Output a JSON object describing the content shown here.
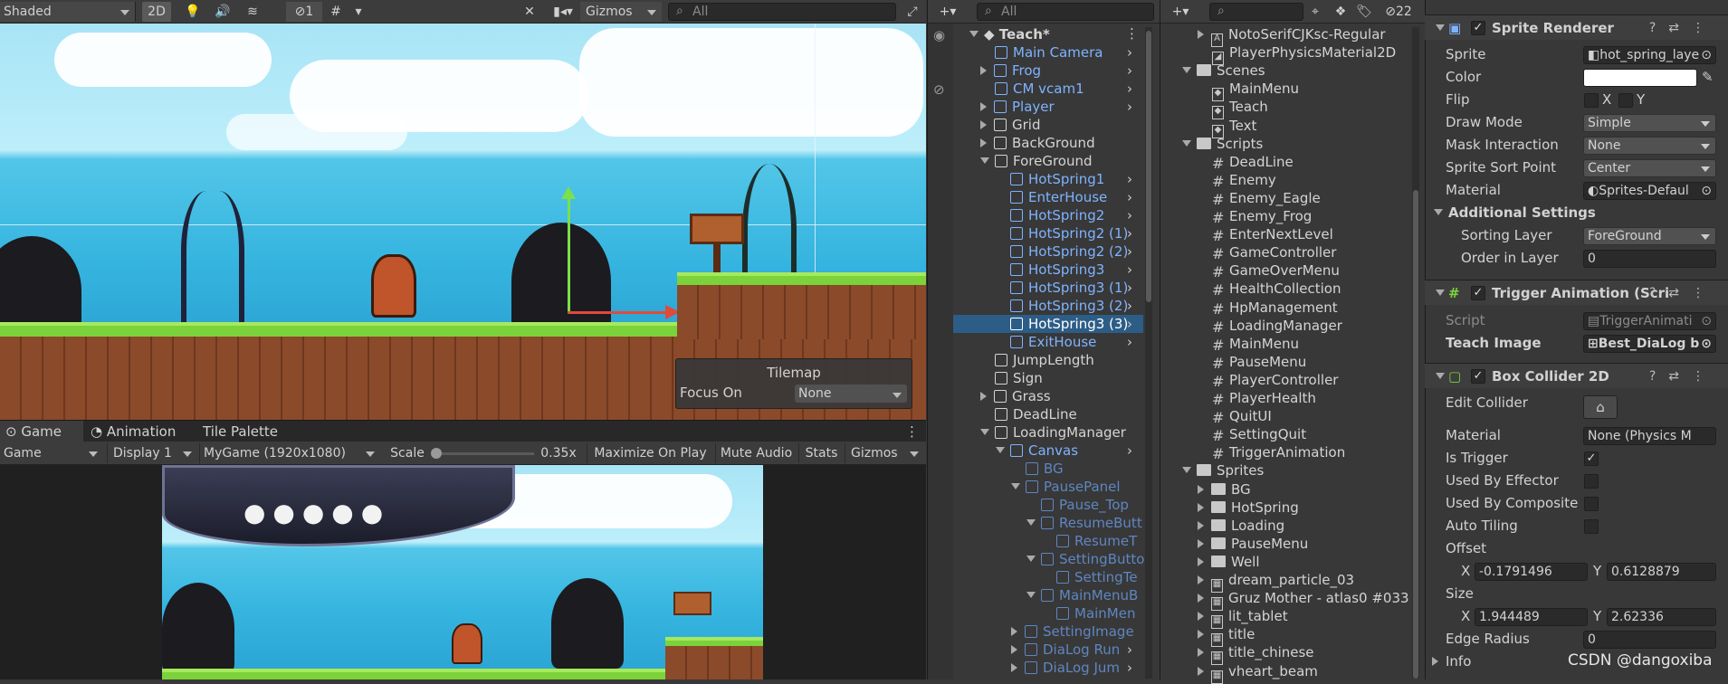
{
  "scene_toolbar": {
    "shading_mode": "Shaded",
    "mode_2d": "2D",
    "hidden_count": "1",
    "gizmos": "Gizmos",
    "search_placeholder": "All"
  },
  "tilemap_overlay": {
    "title": "Tilemap",
    "focus_label": "Focus On",
    "focus_value": "None"
  },
  "game_tabs": {
    "game": "Game",
    "animation": "Animation",
    "tile_palette": "Tile Palette"
  },
  "game_toolbar": {
    "view": "Game",
    "display": "Display 1",
    "resolution": "MyGame (1920x1080)",
    "scale_label": "Scale",
    "scale_value": "0.35x",
    "maximize": "Maximize On Play",
    "mute": "Mute Audio",
    "stats": "Stats",
    "gizmos": "Gizmos"
  },
  "hierarchy": {
    "search_placeholder": "All",
    "scene_name": "Teach*",
    "items": [
      {
        "label": "Main Camera",
        "indent": 1,
        "style": "blue",
        "expand": "",
        "chev": true
      },
      {
        "label": "Frog",
        "indent": 1,
        "style": "blue",
        "expand": "right",
        "chev": true
      },
      {
        "label": "CM vcam1",
        "indent": 1,
        "style": "blue",
        "expand": "",
        "chev": true
      },
      {
        "label": "Player",
        "indent": 1,
        "style": "blue",
        "expand": "right",
        "chev": true
      },
      {
        "label": "Grid",
        "indent": 1,
        "style": "",
        "expand": "right",
        "chev": false
      },
      {
        "label": "BackGround",
        "indent": 1,
        "style": "",
        "expand": "right",
        "chev": false
      },
      {
        "label": "ForeGround",
        "indent": 1,
        "style": "",
        "expand": "down",
        "chev": false
      },
      {
        "label": "HotSpring1",
        "indent": 2,
        "style": "blue",
        "expand": "",
        "chev": true
      },
      {
        "label": "EnterHouse",
        "indent": 2,
        "style": "blue",
        "expand": "",
        "chev": true
      },
      {
        "label": "HotSpring2",
        "indent": 2,
        "style": "blue",
        "expand": "",
        "chev": true
      },
      {
        "label": "HotSpring2 (1)",
        "indent": 2,
        "style": "blue",
        "expand": "",
        "chev": true
      },
      {
        "label": "HotSpring2 (2)",
        "indent": 2,
        "style": "blue",
        "expand": "",
        "chev": true
      },
      {
        "label": "HotSpring3",
        "indent": 2,
        "style": "blue",
        "expand": "",
        "chev": true
      },
      {
        "label": "HotSpring3 (1)",
        "indent": 2,
        "style": "blue",
        "expand": "",
        "chev": true
      },
      {
        "label": "HotSpring3 (2)",
        "indent": 2,
        "style": "blue",
        "expand": "",
        "chev": true
      },
      {
        "label": "HotSpring3 (3)",
        "indent": 2,
        "style": "selected",
        "expand": "",
        "chev": true
      },
      {
        "label": "ExitHouse",
        "indent": 2,
        "style": "blue",
        "expand": "",
        "chev": true
      },
      {
        "label": "JumpLength",
        "indent": 1,
        "style": "",
        "expand": "",
        "chev": false
      },
      {
        "label": "Sign",
        "indent": 1,
        "style": "",
        "expand": "",
        "chev": false
      },
      {
        "label": "Grass",
        "indent": 1,
        "style": "",
        "expand": "right",
        "chev": false
      },
      {
        "label": "DeadLine",
        "indent": 1,
        "style": "",
        "expand": "",
        "chev": false
      },
      {
        "label": "LoadingManager",
        "indent": 1,
        "style": "",
        "expand": "down",
        "chev": false
      },
      {
        "label": "Canvas",
        "indent": 2,
        "style": "blue",
        "expand": "down",
        "chev": true
      },
      {
        "label": "BG",
        "indent": 3,
        "style": "dim",
        "expand": "",
        "chev": false
      },
      {
        "label": "PausePanel",
        "indent": 3,
        "style": "dim",
        "expand": "down",
        "chev": false
      },
      {
        "label": "Pause_Top",
        "indent": 4,
        "style": "dim",
        "expand": "",
        "chev": false
      },
      {
        "label": "ResumeButt",
        "indent": 4,
        "style": "dim",
        "expand": "down",
        "chev": false
      },
      {
        "label": "ResumeT",
        "indent": 5,
        "style": "dim",
        "expand": "",
        "chev": false
      },
      {
        "label": "SettingButto",
        "indent": 4,
        "style": "dim",
        "expand": "down",
        "chev": false
      },
      {
        "label": "SettingTe",
        "indent": 5,
        "style": "dim",
        "expand": "",
        "chev": false
      },
      {
        "label": "MainMenuB",
        "indent": 4,
        "style": "dim",
        "expand": "down",
        "chev": false
      },
      {
        "label": "MainMen",
        "indent": 5,
        "style": "dim",
        "expand": "",
        "chev": false
      },
      {
        "label": "SettingImage",
        "indent": 3,
        "style": "dim",
        "expand": "right",
        "chev": false
      },
      {
        "label": "DiaLog Run",
        "indent": 3,
        "style": "dim",
        "expand": "right",
        "chev": true
      },
      {
        "label": "DiaLog Jum",
        "indent": 3,
        "style": "dim",
        "expand": "right",
        "chev": true
      }
    ]
  },
  "project": {
    "search_placeholder": "",
    "badge_count": "22",
    "items": [
      {
        "label": "NotoSerifCJKsc-Regular",
        "indent": 1,
        "icon": "font",
        "expand": "right"
      },
      {
        "label": "PlayerPhysicsMaterial2D",
        "indent": 1,
        "icon": "material",
        "expand": ""
      },
      {
        "label": "Scenes",
        "indent": 0,
        "icon": "folder",
        "expand": "down"
      },
      {
        "label": "MainMenu",
        "indent": 1,
        "icon": "scene",
        "expand": ""
      },
      {
        "label": "Teach",
        "indent": 1,
        "icon": "scene",
        "expand": ""
      },
      {
        "label": "Text",
        "indent": 1,
        "icon": "scene",
        "expand": ""
      },
      {
        "label": "Scripts",
        "indent": 0,
        "icon": "folder",
        "expand": "down"
      },
      {
        "label": "DeadLine",
        "indent": 1,
        "icon": "script",
        "expand": ""
      },
      {
        "label": "Enemy",
        "indent": 1,
        "icon": "script",
        "expand": ""
      },
      {
        "label": "Enemy_Eagle",
        "indent": 1,
        "icon": "script",
        "expand": ""
      },
      {
        "label": "Enemy_Frog",
        "indent": 1,
        "icon": "script",
        "expand": ""
      },
      {
        "label": "EnterNextLevel",
        "indent": 1,
        "icon": "script",
        "expand": ""
      },
      {
        "label": "GameController",
        "indent": 1,
        "icon": "script",
        "expand": ""
      },
      {
        "label": "GameOverMenu",
        "indent": 1,
        "icon": "script",
        "expand": ""
      },
      {
        "label": "HealthCollection",
        "indent": 1,
        "icon": "script",
        "expand": ""
      },
      {
        "label": "HpManagement",
        "indent": 1,
        "icon": "script",
        "expand": ""
      },
      {
        "label": "LoadingManager",
        "indent": 1,
        "icon": "script",
        "expand": ""
      },
      {
        "label": "MainMenu",
        "indent": 1,
        "icon": "script",
        "expand": ""
      },
      {
        "label": "PauseMenu",
        "indent": 1,
        "icon": "script",
        "expand": ""
      },
      {
        "label": "PlayerController",
        "indent": 1,
        "icon": "script",
        "expand": ""
      },
      {
        "label": "PlayerHealth",
        "indent": 1,
        "icon": "script",
        "expand": ""
      },
      {
        "label": "QuitUI",
        "indent": 1,
        "icon": "script",
        "expand": ""
      },
      {
        "label": "SettingQuit",
        "indent": 1,
        "icon": "script",
        "expand": ""
      },
      {
        "label": "TriggerAnimation",
        "indent": 1,
        "icon": "script",
        "expand": ""
      },
      {
        "label": "Sprites",
        "indent": 0,
        "icon": "folder",
        "expand": "down"
      },
      {
        "label": "BG",
        "indent": 1,
        "icon": "folder",
        "expand": "right"
      },
      {
        "label": "HotSpring",
        "indent": 1,
        "icon": "folder",
        "expand": "right"
      },
      {
        "label": "Loading",
        "indent": 1,
        "icon": "folder",
        "expand": "right"
      },
      {
        "label": "PauseMenu",
        "indent": 1,
        "icon": "folder",
        "expand": "right"
      },
      {
        "label": "Well",
        "indent": 1,
        "icon": "folder",
        "expand": "right"
      },
      {
        "label": "dream_particle_03",
        "indent": 1,
        "icon": "sprite",
        "expand": "right"
      },
      {
        "label": "Gruz Mother - atlas0 #033",
        "indent": 1,
        "icon": "sprite",
        "expand": "right"
      },
      {
        "label": "lit_tablet",
        "indent": 1,
        "icon": "sprite",
        "expand": "right"
      },
      {
        "label": "title",
        "indent": 1,
        "icon": "sprite",
        "expand": "right"
      },
      {
        "label": "title_chinese",
        "indent": 1,
        "icon": "sprite",
        "expand": "right"
      },
      {
        "label": "vheart_beam",
        "indent": 1,
        "icon": "sprite",
        "expand": "right"
      }
    ]
  },
  "inspector": {
    "sprite_renderer": {
      "title": "Sprite Renderer",
      "sprite_label": "Sprite",
      "sprite_value": "hot_spring_laye",
      "color_label": "Color",
      "color_value": "#ffffff",
      "flip_label": "Flip",
      "flip_x": "X",
      "flip_y": "Y",
      "draw_mode_label": "Draw Mode",
      "draw_mode_value": "Simple",
      "mask_label": "Mask Interaction",
      "mask_value": "None",
      "sort_point_label": "Sprite Sort Point",
      "sort_point_value": "Center",
      "material_label": "Material",
      "material_value": "Sprites-Defaul",
      "additional": "Additional Settings",
      "sorting_layer_label": "Sorting Layer",
      "sorting_layer_value": "ForeGround",
      "order_label": "Order in Layer",
      "order_value": "0"
    },
    "trigger_animation": {
      "title": "Trigger Animation (Scri",
      "script_label": "Script",
      "script_value": "TriggerAnimati",
      "teach_label": "Teach Image",
      "teach_value": "Best_DiaLog b"
    },
    "box_collider": {
      "title": "Box Collider 2D",
      "edit_label": "Edit Collider",
      "material_label": "Material",
      "material_value": "None (Physics M",
      "trigger_label": "Is Trigger",
      "effector_label": "Used By Effector",
      "composite_label": "Used By Composite",
      "autotiling_label": "Auto Tiling",
      "offset_label": "Offset",
      "offset_x": "-0.1791496",
      "offset_y": "0.6128879",
      "size_label": "Size",
      "size_x": "1.944489",
      "size_y": "2.62336",
      "edge_label": "Edge Radius",
      "edge_value": "0",
      "info_label": "Info",
      "axis_x": "X",
      "axis_y": "Y"
    }
  },
  "watermark": "CSDN @dangoxiba"
}
